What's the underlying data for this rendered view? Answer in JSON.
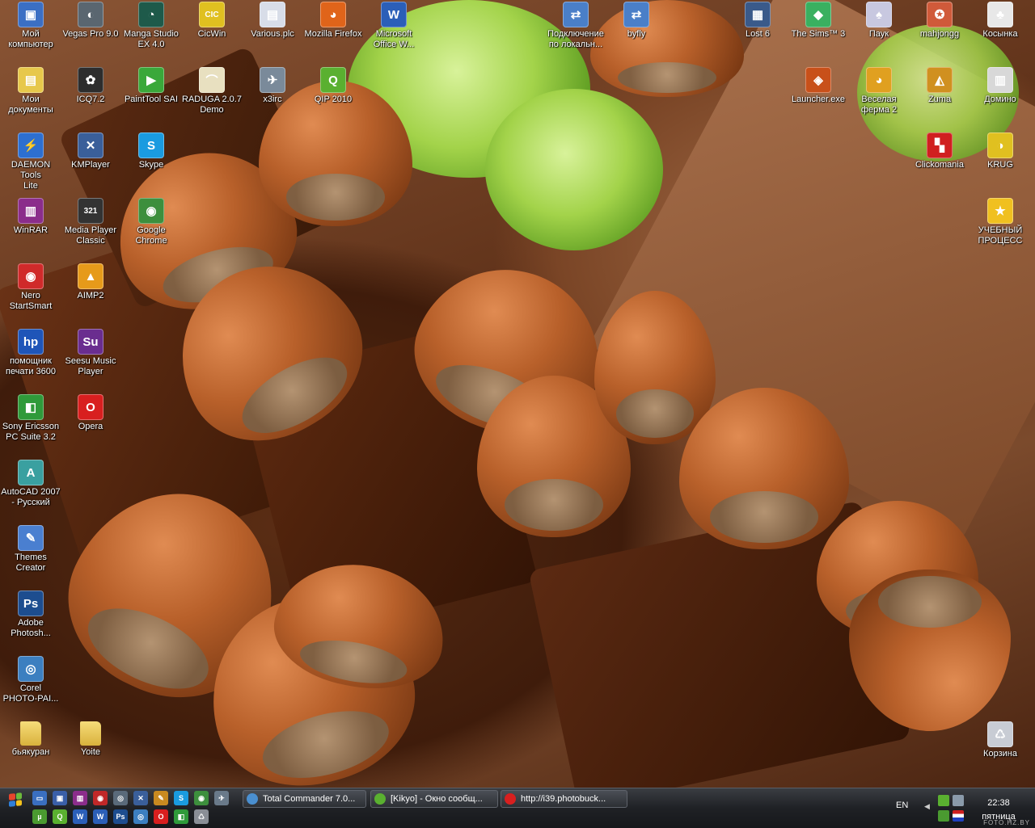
{
  "desktop": {
    "icons": [
      {
        "label": "Мой\nкомпьютер",
        "icon": "my-computer-icon",
        "color": "#3b6fc4",
        "glyph": "▣"
      },
      {
        "label": "Мои\nдокументы",
        "icon": "my-documents-icon",
        "color": "#e7c84b",
        "glyph": "▤"
      },
      {
        "label": "DAEMON Tools\nLite",
        "icon": "daemon-tools-icon",
        "color": "#2d6fd0",
        "glyph": "⚡"
      },
      {
        "label": "WinRAR",
        "icon": "winrar-icon",
        "color": "#8b2d8b",
        "glyph": "▥"
      },
      {
        "label": "Nero\nStartSmart",
        "icon": "nero-icon",
        "color": "#d02a2a",
        "glyph": "◉"
      },
      {
        "label": "помощник\nпечати 3600",
        "icon": "hp-printer-icon",
        "color": "#1f55b8",
        "glyph": "hp"
      },
      {
        "label": "Sony Ericsson\nPC Suite 3.2",
        "icon": "sony-ericsson-icon",
        "color": "#2f9a3a",
        "glyph": "◧"
      },
      {
        "label": "AutoCAD 2007\n- Русский",
        "icon": "autocad-icon",
        "color": "#3aa0a0",
        "glyph": "A"
      },
      {
        "label": "Themes\nCreator",
        "icon": "themes-creator-icon",
        "color": "#4a7fd0",
        "glyph": "✎"
      },
      {
        "label": "Adobe\nPhotosh...",
        "icon": "photoshop-icon",
        "color": "#1d4d8f",
        "glyph": "Ps"
      },
      {
        "label": "Corel\nPHOTO-PAI...",
        "icon": "corel-photopaint-icon",
        "color": "#3c7fc0",
        "glyph": "◎"
      },
      {
        "label": "бьякуран",
        "icon": "folder-icon",
        "color": "#e9c84e",
        "glyph": ""
      },
      {
        "label": "Vegas Pro 9.0",
        "icon": "vegas-pro-icon",
        "color": "#5a6670",
        "glyph": "◐"
      },
      {
        "label": "ICQ7.2",
        "icon": "icq-icon",
        "color": "#2d2d2d",
        "glyph": "✿"
      },
      {
        "label": "KMPlayer",
        "icon": "kmplayer-icon",
        "color": "#3a5f9a",
        "glyph": "✕"
      },
      {
        "label": "Media Player\nClassic",
        "icon": "media-player-classic-icon",
        "color": "#333333",
        "glyph": "321"
      },
      {
        "label": "AIMP2",
        "icon": "aimp-icon",
        "color": "#e69a1a",
        "glyph": "▲"
      },
      {
        "label": "Seesu Music\nPlayer",
        "icon": "seesu-icon",
        "color": "#6a2d8f",
        "glyph": "Su"
      },
      {
        "label": "Opera",
        "icon": "opera-icon",
        "color": "#d81f1f",
        "glyph": "O"
      },
      {
        "label": "Yoite",
        "icon": "folder-icon",
        "color": "#e9c84e",
        "glyph": ""
      },
      {
        "label": "Manga Studio\nEX 4.0",
        "icon": "manga-studio-icon",
        "color": "#1e5a4a",
        "glyph": "◔"
      },
      {
        "label": "PaintTool SAI",
        "icon": "painttool-sai-icon",
        "color": "#3aa83a",
        "glyph": "▶"
      },
      {
        "label": "Skype",
        "icon": "skype-icon",
        "color": "#1a9be0",
        "glyph": "S"
      },
      {
        "label": "Google\nChrome",
        "icon": "chrome-icon",
        "color": "#3d8f3d",
        "glyph": "◉"
      },
      {
        "label": "CicWin",
        "icon": "cicwin-icon",
        "color": "#e0c020",
        "glyph": "CIC"
      },
      {
        "label": "RADUGA 2.0.7\nDemo",
        "icon": "raduga-icon",
        "color": "#e8e0c0",
        "glyph": "⌒"
      },
      {
        "label": "Various.plc",
        "icon": "document-icon",
        "color": "#d8dde8",
        "glyph": "▤"
      },
      {
        "label": "x3irc",
        "icon": "x3irc-icon",
        "color": "#7a8a9a",
        "glyph": "✈"
      },
      {
        "label": "Mozilla Firefox",
        "icon": "firefox-icon",
        "color": "#e0641a",
        "glyph": "◕"
      },
      {
        "label": "QIP 2010",
        "icon": "qip-icon",
        "color": "#5ab030",
        "glyph": "Q"
      },
      {
        "label": "Microsoft\nOffice W...",
        "icon": "ms-word-icon",
        "color": "#2b5fb8",
        "glyph": "W"
      },
      {
        "label": "Подключение\nпо локальн...",
        "icon": "network-connection-icon",
        "color": "#4a7fc8",
        "glyph": "⇄"
      },
      {
        "label": "byfly",
        "icon": "byfly-icon",
        "color": "#4a7fc8",
        "glyph": "⇄"
      },
      {
        "label": "Lost 6",
        "icon": "lost-icon",
        "color": "#3a5a8a",
        "glyph": "▦"
      },
      {
        "label": "The Sims™ 3",
        "icon": "sims-icon",
        "color": "#3ab060",
        "glyph": "◆"
      },
      {
        "label": "Паук",
        "icon": "spider-solitaire-icon",
        "color": "#c8c8e0",
        "glyph": "♠"
      },
      {
        "label": "mahjongg",
        "icon": "mahjongg-icon",
        "color": "#d05a3a",
        "glyph": "✪"
      },
      {
        "label": "Косынка",
        "icon": "solitaire-icon",
        "color": "#e8e8e8",
        "glyph": "♣"
      },
      {
        "label": "Launcher.exe",
        "icon": "launcher-icon",
        "color": "#c8501a",
        "glyph": "◈"
      },
      {
        "label": "Веселая\nферма 2",
        "icon": "farm-icon",
        "color": "#e0a020",
        "glyph": "◕"
      },
      {
        "label": "Zuma",
        "icon": "zuma-icon",
        "color": "#d09020",
        "glyph": "◭"
      },
      {
        "label": "Домино",
        "icon": "domino-icon",
        "color": "#d8d8d8",
        "glyph": "▥"
      },
      {
        "label": "Clickomania",
        "icon": "clickomania-icon",
        "color": "#d02020",
        "glyph": "▚"
      },
      {
        "label": "KRUG",
        "icon": "krug-icon",
        "color": "#e0c020",
        "glyph": "◑"
      },
      {
        "label": "УЧЕБНЫЙ\nПРОЦЕСС",
        "icon": "star-icon",
        "color": "#f0c020",
        "glyph": "★"
      },
      {
        "label": "Корзина",
        "icon": "recycle-bin-icon",
        "color": "#c8ccd4",
        "glyph": "♺"
      }
    ]
  },
  "taskbar": {
    "quick_launch": [
      {
        "icon": "show-desktop-icon",
        "color": "#3a6fc0",
        "glyph": "▭"
      },
      {
        "icon": "save-icon",
        "color": "#3a5fa8",
        "glyph": "▣"
      },
      {
        "icon": "winrar-icon",
        "color": "#8b2d8b",
        "glyph": "▥"
      },
      {
        "icon": "nero-icon",
        "color": "#c02828",
        "glyph": "◉"
      },
      {
        "icon": "network-icon",
        "color": "#5a6a7a",
        "glyph": "◎"
      },
      {
        "icon": "kmplayer-icon",
        "color": "#3a5f9a",
        "glyph": "✕"
      },
      {
        "icon": "painttool-icon",
        "color": "#c88a20",
        "glyph": "✎"
      },
      {
        "icon": "skype-icon",
        "color": "#1a9be0",
        "glyph": "S"
      },
      {
        "icon": "chrome-icon",
        "color": "#3d8f3d",
        "glyph": "◉"
      },
      {
        "icon": "x3irc-icon",
        "color": "#6a7a8a",
        "glyph": "✈"
      },
      {
        "icon": "utorrent-icon",
        "color": "#4a9a30",
        "glyph": "µ"
      },
      {
        "icon": "qip-icon",
        "color": "#5ab030",
        "glyph": "Q"
      },
      {
        "icon": "ms-word-icon",
        "color": "#2b5fb8",
        "glyph": "W"
      },
      {
        "icon": "ms-word-icon",
        "color": "#2b5fb8",
        "glyph": "W"
      },
      {
        "icon": "photoshop-icon",
        "color": "#1d4d8f",
        "glyph": "Ps"
      },
      {
        "icon": "corel-icon",
        "color": "#3c7fc0",
        "glyph": "◎"
      },
      {
        "icon": "opera-icon",
        "color": "#d81f1f",
        "glyph": "O"
      },
      {
        "icon": "sony-ericsson-icon",
        "color": "#2f9a3a",
        "glyph": "◧"
      },
      {
        "icon": "recycle-bin-icon",
        "color": "#8a8e96",
        "glyph": "♺"
      }
    ],
    "tasks": [
      {
        "label": "Total Commander 7.0...",
        "icon": "total-commander-icon",
        "color": "#4a8fd0"
      },
      {
        "label": "[Kikyo] - Окно сообщ...",
        "icon": "qip-message-icon",
        "color": "#5ab030"
      },
      {
        "label": "http://i39.photobuck...",
        "icon": "opera-icon",
        "color": "#d81f1f"
      }
    ],
    "tray": {
      "language": "EN",
      "time": "22:38",
      "day": "пятница"
    }
  },
  "watermark": "FOTO.HZ.BY"
}
